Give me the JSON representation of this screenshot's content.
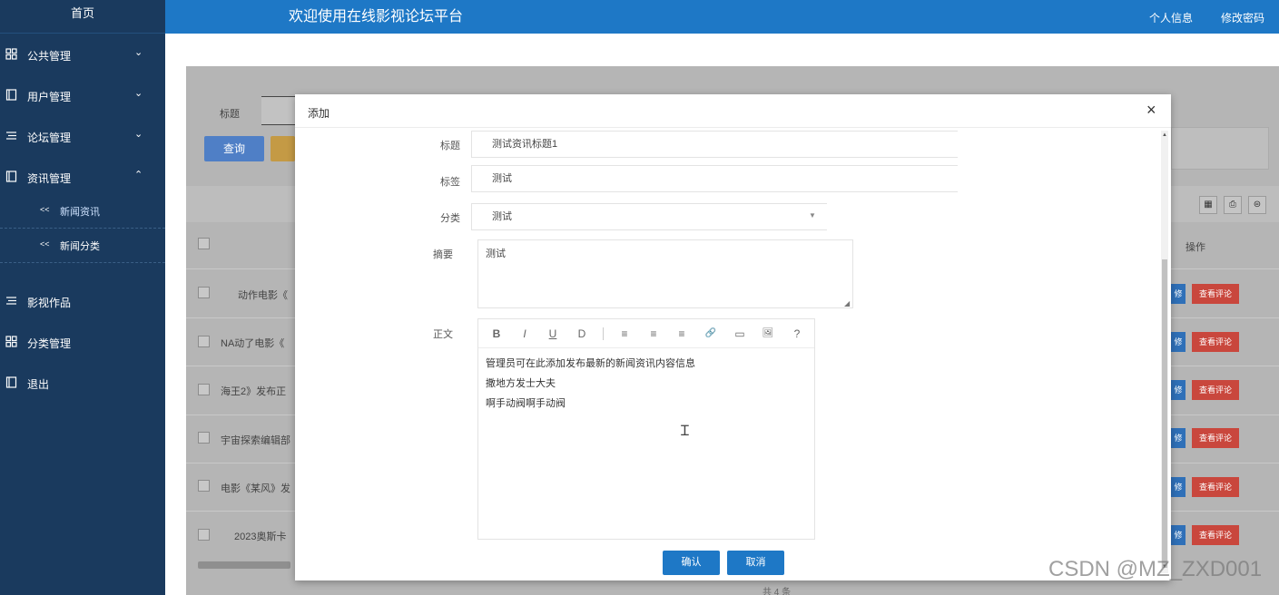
{
  "app": {
    "sidebar_top": "首页",
    "title": "欢迎使用在线影视论坛平台",
    "profile_link": "个人信息",
    "password_link": "修改密码"
  },
  "sidebar": {
    "items": [
      {
        "label": "公共管理",
        "icon": "grid-icon",
        "chevron": "⌄"
      },
      {
        "label": "用户管理",
        "icon": "book-icon",
        "chevron": "⌄"
      },
      {
        "label": "论坛管理",
        "icon": "list-icon",
        "chevron": "⌄"
      },
      {
        "label": "资讯管理",
        "icon": "book-icon",
        "chevron": "⌃"
      },
      {
        "label": "影视作品",
        "icon": "list-icon"
      },
      {
        "label": "分类管理",
        "icon": "grid-icon"
      },
      {
        "label": "退出",
        "icon": "book-icon"
      }
    ],
    "sub_items": [
      {
        "label": "新闻资讯",
        "arrow": "<<"
      },
      {
        "label": "新闻分类",
        "arrow": "<<"
      }
    ]
  },
  "background": {
    "search_label": "标题",
    "search_button": "查询",
    "column_action": "操作",
    "rows": [
      {
        "title": "动作电影《",
        "view": "查看评论",
        "edit": "修"
      },
      {
        "title": "NA动了电影《",
        "view": "查看评论",
        "edit": "修"
      },
      {
        "title": "海王2》发布正",
        "view": "查看评论",
        "edit": "修"
      },
      {
        "title": "宇宙探索编辑部",
        "view": "查看评论",
        "edit": "修"
      },
      {
        "title": "电影《某风》发",
        "view": "查看评论",
        "edit": "修"
      },
      {
        "title": "2023奥斯卡",
        "view": "查看评论",
        "edit": "修"
      }
    ],
    "pagination_text": "共 4 条"
  },
  "modal": {
    "title": "添加",
    "close": "×",
    "fields": {
      "title_label": "标题",
      "title_value": "测试资讯标题1",
      "tag_label": "标签",
      "tag_value": "测试",
      "category_label": "分类",
      "category_value": "测试",
      "summary_label": "摘要",
      "summary_value": "测试",
      "content_label": "正文"
    },
    "editor": {
      "toolbar": [
        "B",
        "I",
        "U",
        "D",
        "≡",
        "≡",
        "≡",
        "🔗",
        "▭",
        "🖼",
        "?"
      ],
      "lines": [
        "管理员可在此添加发布最新的新闻资讯内容信息",
        "撒地方发士大夫",
        "啊手动阀啊手动阀"
      ]
    },
    "confirm": "确认",
    "cancel": "取消"
  },
  "watermark": "CSDN @MZ_ZXD001"
}
